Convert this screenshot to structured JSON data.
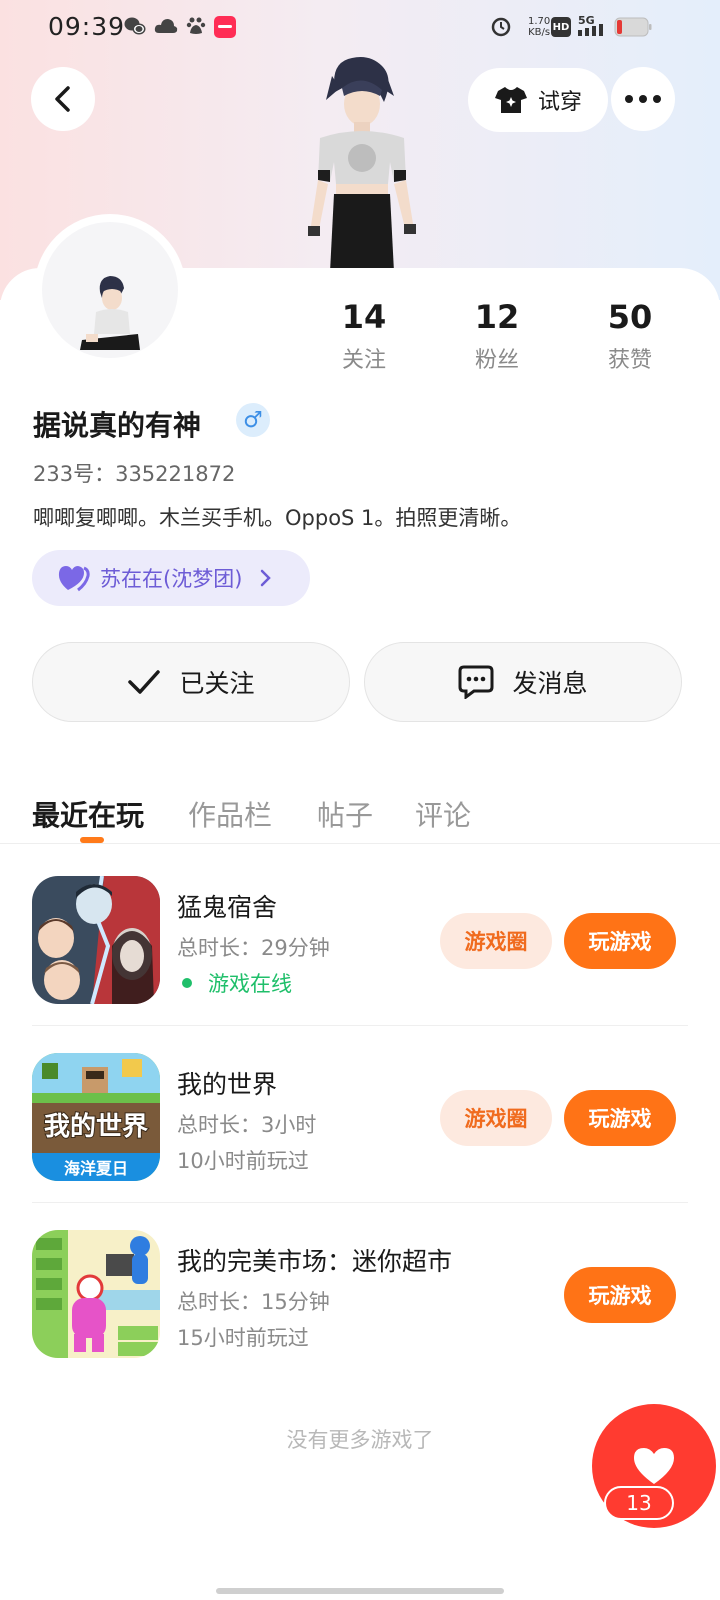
{
  "status_bar": {
    "time": "09:39",
    "net_speed_value": "1.70",
    "net_speed_unit": "KB/s",
    "hd": "HD",
    "signal": "5G"
  },
  "header": {
    "try_on_label": "试穿",
    "back_icon": "chevron-left-icon",
    "more_icon": "more-dots-icon"
  },
  "profile": {
    "stats": [
      {
        "value": "14",
        "label": "关注"
      },
      {
        "value": "12",
        "label": "粉丝"
      },
      {
        "value": "50",
        "label": "获赞"
      }
    ],
    "name": "据说真的有神",
    "gender_symbol": "♂",
    "uid": "233号：335221872",
    "bio": "唧唧复唧唧。木兰买手机。OppoS 1。拍照更清晰。",
    "cp_label": "苏在在(沈梦团)"
  },
  "actions": {
    "follow_label": "已关注",
    "message_label": "发消息"
  },
  "tabs": [
    {
      "label": "最近在玩",
      "active": true
    },
    {
      "label": "作品栏",
      "active": false
    },
    {
      "label": "帖子",
      "active": false
    },
    {
      "label": "评论",
      "active": false
    }
  ],
  "games": [
    {
      "title": "猛鬼宿舍",
      "duration": "总时长：29分钟",
      "status": "游戏在线",
      "circle_label": "游戏圈",
      "play_label": "玩游戏"
    },
    {
      "title": "我的世界",
      "duration": "总时长：3小时",
      "last_played": "10小时前玩过",
      "circle_label": "游戏圈",
      "play_label": "玩游戏"
    },
    {
      "title": "我的完美市场：迷你超市",
      "duration": "总时长：15分钟",
      "last_played": "15小时前玩过",
      "play_label": "玩游戏"
    }
  ],
  "icon_texts": {
    "minecraft_title": "我的世界",
    "minecraft_sub": "海洋夏日"
  },
  "footer": {
    "no_more": "没有更多游戏了",
    "like_count": "13"
  },
  "colors": {
    "accent": "#ff7316",
    "online": "#1fbf6a",
    "like": "#ff3b30",
    "cp_chip_text": "#6d5cd6"
  }
}
